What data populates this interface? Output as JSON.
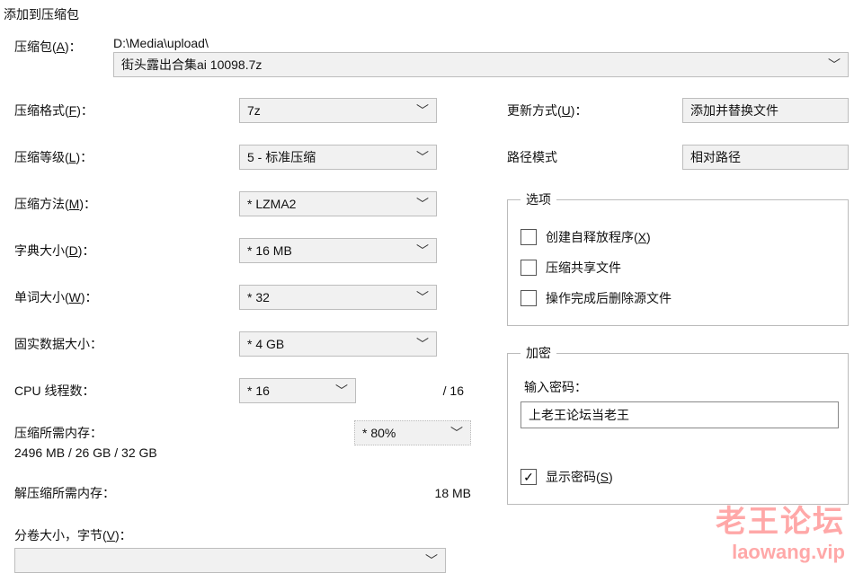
{
  "title": "添加到压缩包",
  "archive": {
    "label": "压缩包(A)：",
    "path": "D:\\Media\\upload\\",
    "filename": "街头露出合集ai 10098.7z"
  },
  "left": {
    "format_label": "压缩格式(F)：",
    "format_value": "7z",
    "level_label": "压缩等级(L)：",
    "level_value": "5 - 标准压缩",
    "method_label": "压缩方法(M)：",
    "method_value": "* LZMA2",
    "dict_label": "字典大小(D)：",
    "dict_value": "* 16 MB",
    "word_label": "单词大小(W)：",
    "word_value": "* 32",
    "solid_label": "固实数据大小：",
    "solid_value": "* 4 GB",
    "cpu_label": "CPU 线程数：",
    "cpu_value": "* 16",
    "cpu_total": "/ 16",
    "mem_req_label": "压缩所需内存：",
    "mem_req_value": "2496 MB / 26 GB / 32 GB",
    "mem_pct_value": "* 80%",
    "decomp_label": "解压缩所需内存：",
    "decomp_value": "18 MB",
    "split_label": "分卷大小，字节(V)："
  },
  "right": {
    "update_label": "更新方式(U)：",
    "update_value": "添加并替换文件",
    "pathmode_label": "路径模式",
    "pathmode_value": "相对路径",
    "options_legend": "选项",
    "opt_sfx": "创建自释放程序(X)",
    "opt_shared": "压缩共享文件",
    "opt_delete": "操作完成后删除源文件",
    "enc_legend": "加密",
    "enc_pwd_label": "输入密码：",
    "enc_pwd_value": "上老王论坛当老王",
    "enc_show_label": "显示密码(S)"
  },
  "watermark": {
    "line1": "老王论坛",
    "line2": "laowang.vip"
  }
}
